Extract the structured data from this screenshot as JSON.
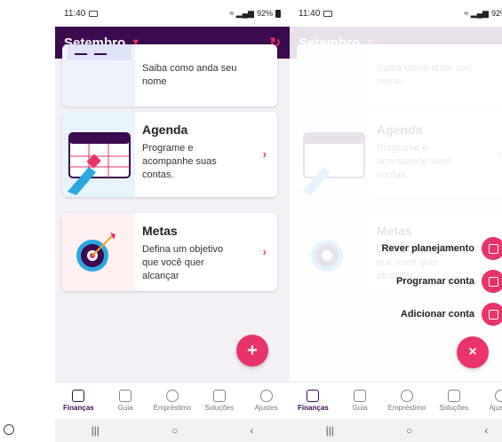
{
  "status": {
    "time": "11:40",
    "battery": "92%",
    "signal": "≈ ▂▄▆"
  },
  "header": {
    "month": "Setembro"
  },
  "cards": [
    {
      "title": "",
      "desc": "Saiba como anda seu nome"
    },
    {
      "title": "Agenda",
      "desc": "Programe e acompanhe suas contas."
    },
    {
      "title": "Metas",
      "desc": "Defina um objetivo que você quer alcançar"
    }
  ],
  "fab": {
    "open_symbol": "+",
    "close_symbol": "×"
  },
  "actions": [
    {
      "label": "Rever planejamento"
    },
    {
      "label": "Programar conta"
    },
    {
      "label": "Adicionar conta"
    }
  ],
  "nav": [
    {
      "label": "Finanças"
    },
    {
      "label": "Guia"
    },
    {
      "label": "Empréstimo"
    },
    {
      "label": "Soluções"
    },
    {
      "label": "Ajustes"
    }
  ],
  "sysnav": {
    "recents": "|||",
    "home": "○",
    "back": "‹"
  },
  "colors": {
    "header": "#3b0a4f",
    "accent": "#e8336b"
  }
}
